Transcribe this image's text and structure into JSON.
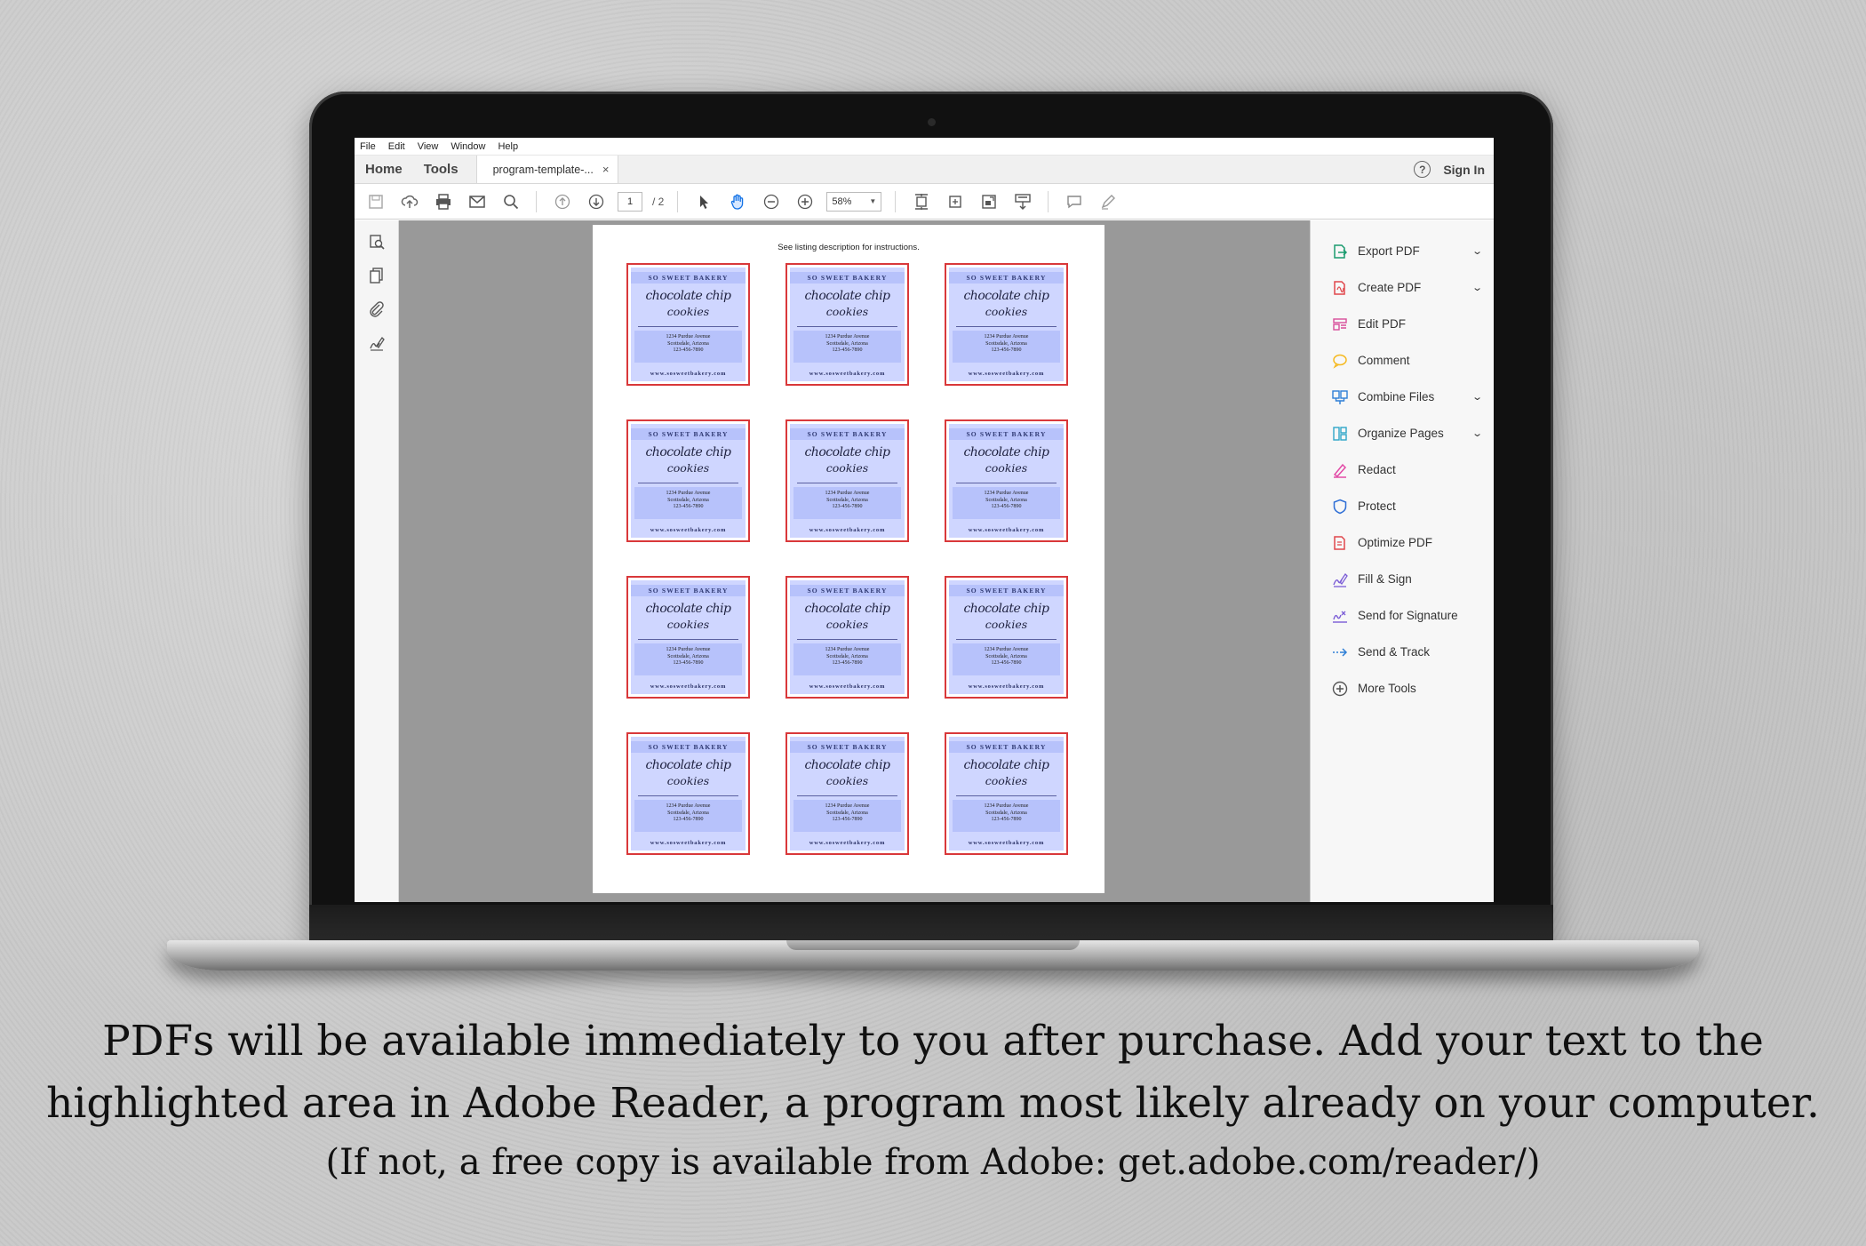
{
  "menu": {
    "items": [
      "File",
      "Edit",
      "View",
      "Window",
      "Help"
    ]
  },
  "tabs": {
    "home": "Home",
    "tools": "Tools",
    "doc": "program-template-...",
    "close": "×"
  },
  "header": {
    "help": "?",
    "signin": "Sign In"
  },
  "toolbar": {
    "page_current": "1",
    "page_total": "/ 2",
    "zoom": "58%"
  },
  "document": {
    "note": "See listing description for instructions.",
    "card": {
      "bakery": "SO SWEET BAKERY",
      "script_line1": "chocolate chip",
      "script_line2": "cookies",
      "address": [
        "1234 Purdue Avenue",
        "Scottsdale, Arizona",
        "123-456-7890"
      ],
      "website": "www.sosweetbakery.com"
    }
  },
  "tools_pane": [
    {
      "label": "Export PDF",
      "icon": "export-pdf-icon",
      "chevron": true,
      "color": "#1a9b6f"
    },
    {
      "label": "Create PDF",
      "icon": "create-pdf-icon",
      "chevron": true,
      "color": "#e0474c"
    },
    {
      "label": "Edit PDF",
      "icon": "edit-pdf-icon",
      "chevron": false,
      "color": "#d84d9a"
    },
    {
      "label": "Comment",
      "icon": "comment-icon",
      "chevron": false,
      "color": "#f5b920"
    },
    {
      "label": "Combine Files",
      "icon": "combine-files-icon",
      "chevron": true,
      "color": "#2f7fd6"
    },
    {
      "label": "Organize Pages",
      "icon": "organize-pages-icon",
      "chevron": true,
      "color": "#2ea6c9"
    },
    {
      "label": "Redact",
      "icon": "redact-icon",
      "chevron": false,
      "color": "#e24aa6"
    },
    {
      "label": "Protect",
      "icon": "protect-icon",
      "chevron": false,
      "color": "#2f6fd6"
    },
    {
      "label": "Optimize PDF",
      "icon": "optimize-pdf-icon",
      "chevron": false,
      "color": "#e0474c"
    },
    {
      "label": "Fill & Sign",
      "icon": "fill-sign-icon",
      "chevron": false,
      "color": "#7b5cd6"
    },
    {
      "label": "Send for Signature",
      "icon": "send-for-signature-icon",
      "chevron": false,
      "color": "#7b5cd6"
    },
    {
      "label": "Send & Track",
      "icon": "send-track-icon",
      "chevron": false,
      "color": "#2f7fd6"
    },
    {
      "label": "More Tools",
      "icon": "more-tools-icon",
      "chevron": false,
      "color": "#555555"
    }
  ],
  "caption": {
    "line1": "PDFs will be available immediately to you after purchase.  Add your text to the",
    "line2": "highlighted area in Adobe Reader, a program most likely already on your computer.",
    "line3": "(If not, a free copy is available from Adobe: get.adobe.com/reader/)"
  },
  "colors": {
    "card_border": "#d9383a",
    "card_fill": "#cfd6ff",
    "card_band": "#b7c2fb",
    "doc_bg": "#999999",
    "accent": "#1473e6"
  }
}
